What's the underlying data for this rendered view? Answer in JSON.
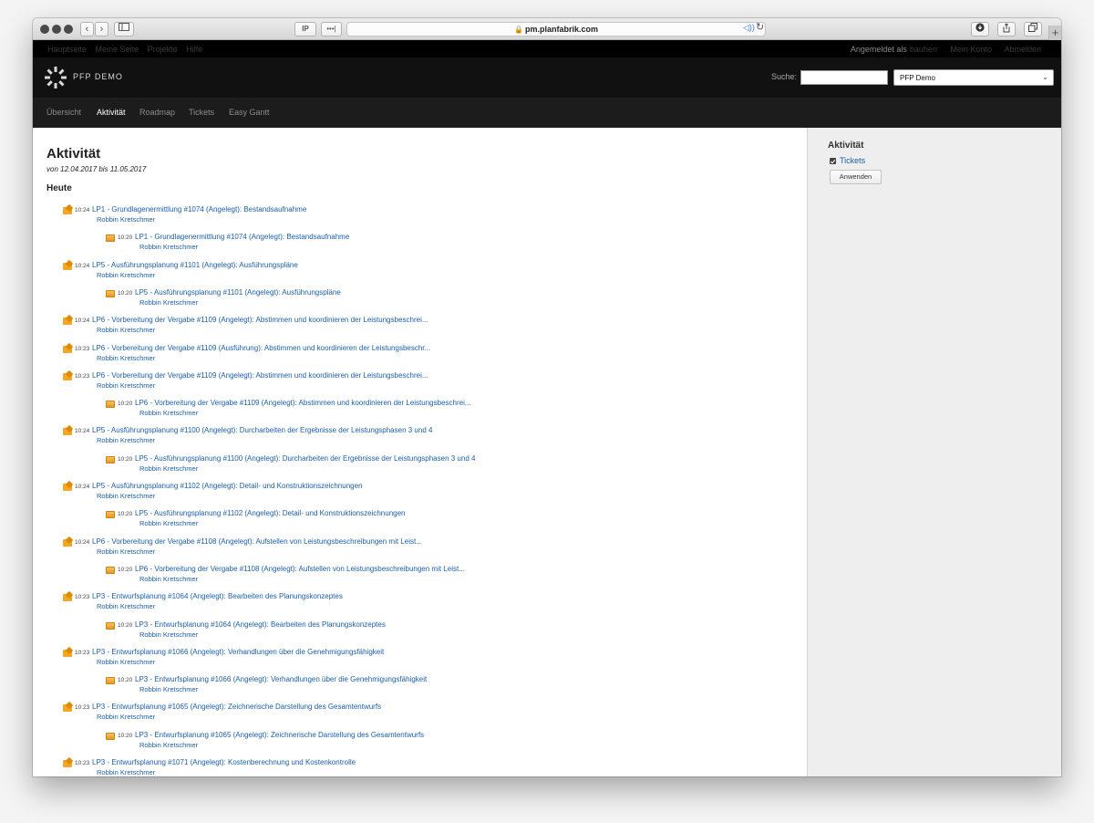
{
  "browser": {
    "address": "pm.planfabrik.com",
    "reader_label": "IP",
    "dots_label": "•••|"
  },
  "topmenu": {
    "items": [
      "Hauptseite",
      "Meine Seite",
      "Projekte",
      "Hilfe"
    ],
    "logged_in_label": "Angemeldet als",
    "user": "bauherr",
    "account": "Mein Konto",
    "logout": "Abmelden"
  },
  "header": {
    "project_title": "PFP DEMO",
    "search_label": "Suche:",
    "search_value": "",
    "project_select": "PFP Demo"
  },
  "mainmenu": {
    "tabs": [
      {
        "label": "Übersicht"
      },
      {
        "label": "Aktivität"
      },
      {
        "label": "Roadmap"
      },
      {
        "label": "Tickets"
      },
      {
        "label": "Easy Gantt"
      }
    ],
    "selected": "Aktivität"
  },
  "content": {
    "title": "Aktivität",
    "range": "von 12.04.2017 bis 11.05.2017",
    "day": "Heute",
    "entries": [
      {
        "time": "10:24",
        "title": "LP1 - Grundlagenermittlung #1074 (Angelegt): Bestandsaufnahme",
        "author": "Robbin Kretschmer",
        "icon": "edit-icon"
      },
      {
        "time": "10:20",
        "title": "LP1 - Grundlagenermittlung #1074 (Angelegt): Bestandsaufnahme",
        "author": "Robbin Kretschmer",
        "icon": "ticket-icon"
      },
      {
        "time": "10:24",
        "title": "LP5 - Ausführungsplanung #1101 (Angelegt): Ausführungspläne",
        "author": "Robbin Kretschmer",
        "icon": "edit-icon"
      },
      {
        "time": "10:20",
        "title": "LP5 - Ausführungsplanung #1101 (Angelegt): Ausführungspläne",
        "author": "Robbin Kretschmer",
        "icon": "ticket-icon"
      },
      {
        "time": "10:24",
        "title": "LP6 - Vorbereitung der Vergabe #1109 (Angelegt): Abstimmen und koordinieren der Leistungsbeschrei...",
        "author": "Robbin Kretschmer",
        "icon": "edit-icon"
      },
      {
        "time": "10:23",
        "title": "LP6 - Vorbereitung der Vergabe #1109 (Ausführung): Abstimmen und koordinieren der Leistungsbeschr...",
        "author": "Robbin Kretschmer",
        "icon": "edit-icon"
      },
      {
        "time": "10:23",
        "title": "LP6 - Vorbereitung der Vergabe #1109 (Angelegt): Abstimmen und koordinieren der Leistungsbeschrei...",
        "author": "Robbin Kretschmer",
        "icon": "edit-icon"
      },
      {
        "time": "10:20",
        "title": "LP6 - Vorbereitung der Vergabe #1109 (Angelegt): Abstimmen und koordinieren der Leistungsbeschrei...",
        "author": "Robbin Kretschmer",
        "icon": "ticket-icon"
      },
      {
        "time": "10:24",
        "title": "LP5 - Ausführungsplanung #1100 (Angelegt): Durcharbeiten der Ergebnisse der Leistungsphasen 3 und 4",
        "author": "Robbin Kretschmer",
        "icon": "edit-icon"
      },
      {
        "time": "10:20",
        "title": "LP5 - Ausführungsplanung #1100 (Angelegt): Durcharbeiten der Ergebnisse der Leistungsphasen 3 und 4",
        "author": "Robbin Kretschmer",
        "icon": "ticket-icon"
      },
      {
        "time": "10:24",
        "title": "LP5 - Ausführungsplanung #1102 (Angelegt): Detail- und Konstruktionszeichnungen",
        "author": "Robbin Kretschmer",
        "icon": "edit-icon"
      },
      {
        "time": "10:20",
        "title": "LP5 - Ausführungsplanung #1102 (Angelegt): Detail- und Konstruktionszeichnungen",
        "author": "Robbin Kretschmer",
        "icon": "ticket-icon"
      },
      {
        "time": "10:24",
        "title": "LP6 - Vorbereitung der Vergabe #1108 (Angelegt): Aufstellen von Leistungsbeschreibungen mit Leist...",
        "author": "Robbin Kretschmer",
        "icon": "edit-icon"
      },
      {
        "time": "10:20",
        "title": "LP6 - Vorbereitung der Vergabe #1108 (Angelegt): Aufstellen von Leistungsbeschreibungen mit Leist...",
        "author": "Robbin Kretschmer",
        "icon": "ticket-icon"
      },
      {
        "time": "10:23",
        "title": "LP3 - Entwurfsplanung #1064 (Angelegt): Bearbeiten des Planungskonzeptes",
        "author": "Robbin Kretschmer",
        "icon": "edit-icon"
      },
      {
        "time": "10:20",
        "title": "LP3 - Entwurfsplanung #1064 (Angelegt): Bearbeiten des Planungskonzeptes",
        "author": "Robbin Kretschmer",
        "icon": "ticket-icon"
      },
      {
        "time": "10:23",
        "title": "LP3 - Entwurfsplanung #1066 (Angelegt): Verhandlungen über die Genehmigungsfähigkeit",
        "author": "Robbin Kretschmer",
        "icon": "edit-icon"
      },
      {
        "time": "10:20",
        "title": "LP3 - Entwurfsplanung #1066 (Angelegt): Verhandlungen über die Genehmigungsfähigkeit",
        "author": "Robbin Kretschmer",
        "icon": "ticket-icon"
      },
      {
        "time": "10:23",
        "title": "LP3 - Entwurfsplanung #1065 (Angelegt): Zeichnerische Darstellung des Gesamtentwurfs",
        "author": "Robbin Kretschmer",
        "icon": "edit-icon"
      },
      {
        "time": "10:20",
        "title": "LP3 - Entwurfsplanung #1065 (Angelegt): Zeichnerische Darstellung des Gesamtentwurfs",
        "author": "Robbin Kretschmer",
        "icon": "ticket-icon"
      },
      {
        "time": "10:23",
        "title": "LP3 - Entwurfsplanung #1071 (Angelegt): Kostenberechnung und Kostenkontrolle",
        "author": "Robbin Kretschmer",
        "icon": "edit-icon"
      }
    ]
  },
  "sidebar": {
    "title": "Aktivität",
    "filter_label": "Tickets",
    "filter_checked": true,
    "apply_label": "Anwenden"
  }
}
